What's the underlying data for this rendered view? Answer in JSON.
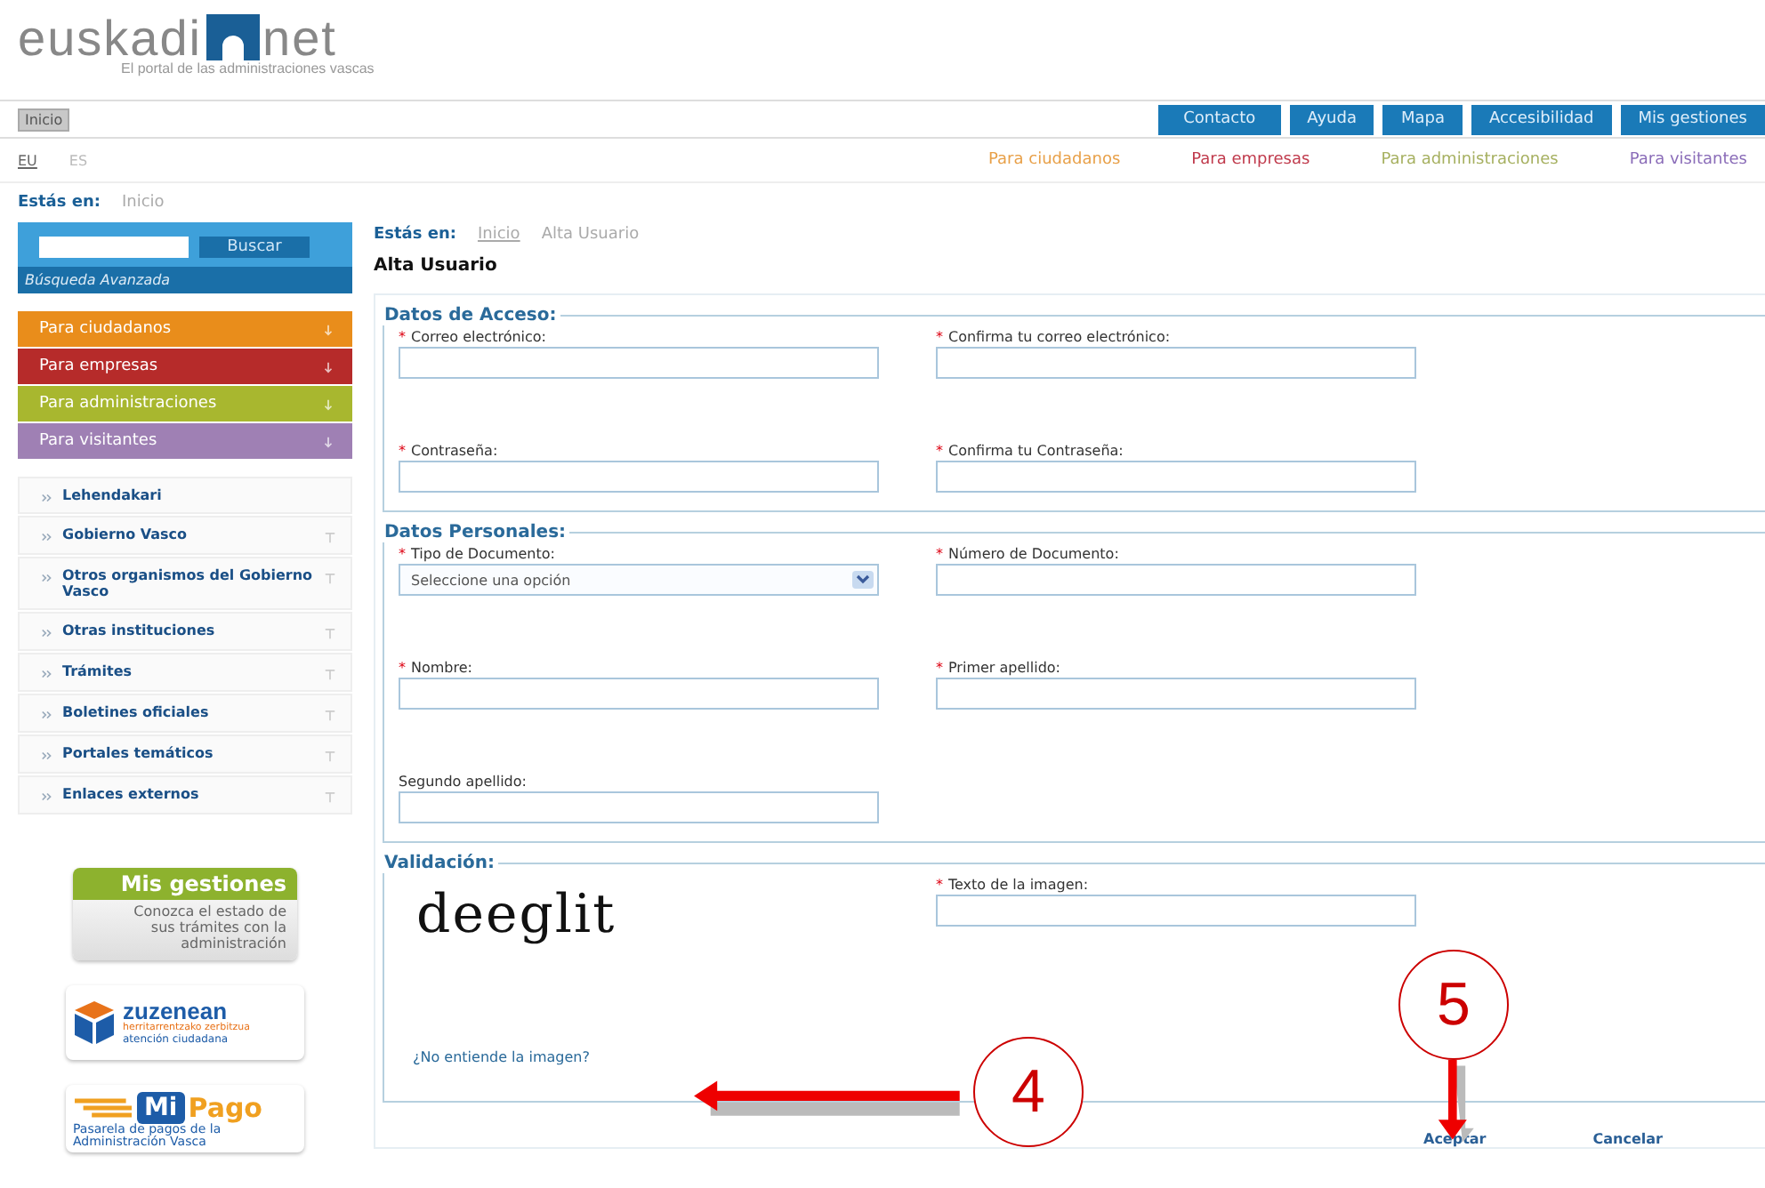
{
  "header": {
    "logo": {
      "word_1": "euskadi",
      "word_2": "net"
    },
    "tagline": "El portal de las administraciones vascas",
    "home_button": "Inicio",
    "nav_buttons": [
      "Contacto",
      "Ayuda",
      "Mapa",
      "Accesibilidad",
      "Mis gestiones"
    ],
    "languages": [
      {
        "label": "EU",
        "selected": true
      },
      {
        "label": "ES",
        "selected": false
      }
    ],
    "audience_links": [
      {
        "label": "Para ciudadanos",
        "color": "#e8a048"
      },
      {
        "label": "Para empresas",
        "color": "#c03a4c"
      },
      {
        "label": "Para administraciones",
        "color": "#a6b060"
      },
      {
        "label": "Para visitantes",
        "color": "#8a6cb8"
      }
    ],
    "breadcrumb": {
      "label": "Estás en:",
      "items": [
        "Inicio"
      ]
    }
  },
  "sidebar": {
    "search": {
      "button": "Buscar",
      "advanced": "Búsqueda Avanzada"
    },
    "audience_menu": [
      {
        "label": "Para ciudadanos",
        "color": "#e8870f"
      },
      {
        "label": "Para empresas",
        "color": "#b3201f"
      },
      {
        "label": "Para administraciones",
        "color": "#a4b424"
      },
      {
        "label": "Para visitantes",
        "color": "#9a7ab0"
      }
    ],
    "menu": [
      {
        "label": "Lehendakari",
        "expandable": false
      },
      {
        "label": "Gobierno Vasco",
        "expandable": true
      },
      {
        "label": "Otros organismos del Gobierno Vasco",
        "expandable": true
      },
      {
        "label": "Otras instituciones",
        "expandable": true
      },
      {
        "label": "Trámites",
        "expandable": true
      },
      {
        "label": "Boletines oficiales",
        "expandable": true
      },
      {
        "label": "Portales temáticos",
        "expandable": true
      },
      {
        "label": "Enlaces externos",
        "expandable": true
      }
    ],
    "banners": {
      "mis_gestiones": {
        "title": "Mis gestiones",
        "text": "Conozca el estado de sus trámites con la administración"
      },
      "zuzenean": {
        "title": "zuzenean",
        "line_1": "herritarrentzako zerbitzua",
        "line_2": "atención ciudadana"
      },
      "mipago": {
        "mi": "Mi",
        "pago": "Pago",
        "text": "Pasarela de pagos de la Administración Vasca"
      }
    }
  },
  "main": {
    "breadcrumb": {
      "label": "Estás en:",
      "items": [
        "Inicio",
        "Alta Usuario"
      ]
    },
    "title": "Alta Usuario",
    "sections": [
      {
        "legend": "Datos de Acceso:",
        "fields": [
          {
            "label": "Correo electrónico:",
            "required_mark": "*",
            "kind": "text"
          },
          {
            "label": "Confirma tu correo electrónico:",
            "required_mark": "*",
            "kind": "text"
          },
          {
            "label": "Contraseña:",
            "required_mark": "*",
            "kind": "text"
          },
          {
            "label": "Confirma tu Contraseña:",
            "required_mark": "*",
            "kind": "text"
          }
        ]
      },
      {
        "legend": "Datos Personales:",
        "fields": [
          {
            "label": "Tipo de Documento:",
            "required_mark": "*",
            "kind": "select",
            "value": "Seleccione una opción"
          },
          {
            "label": "Número de Documento:",
            "required_mark": "*",
            "kind": "text"
          },
          {
            "label": "Nombre:",
            "required_mark": "*",
            "kind": "text"
          },
          {
            "label": "Primer apellido:",
            "required_mark": "*",
            "kind": "text"
          },
          {
            "label": "Segundo apellido:",
            "kind": "text"
          }
        ]
      }
    ],
    "validation": {
      "legend": "Validación:",
      "captcha": "deeglit",
      "field": {
        "label": "Texto de la imagen:",
        "required_mark": "*"
      },
      "link": "¿No entiende la imagen?"
    },
    "buttons": [
      "Aceptar",
      "Cancelar"
    ]
  },
  "annotations": [
    {
      "number": "4"
    },
    {
      "number": "5"
    }
  ]
}
